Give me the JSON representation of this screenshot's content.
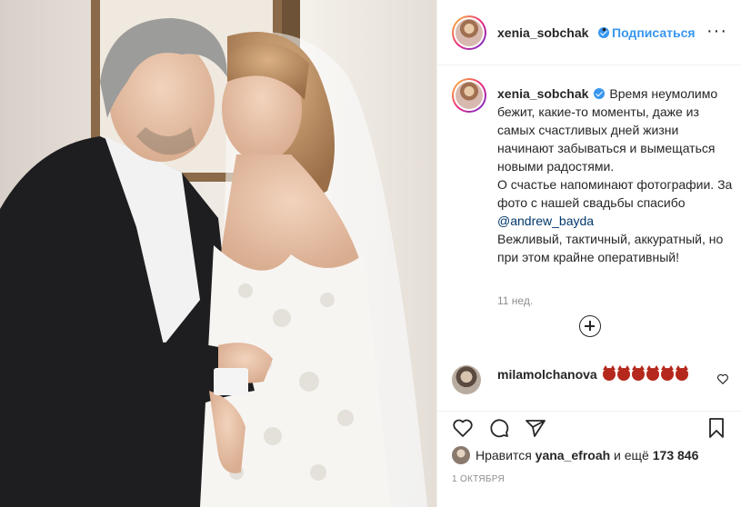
{
  "post": {
    "author": "xenia_sobchak",
    "follow_label": "Подписаться",
    "separator": "•",
    "more_label": "···"
  },
  "caption": {
    "author": "xenia_sobchak",
    "text_1": "Время неумолимо бежит, какие-то моменты, даже из самых счастливых дней жизни начинают забываться и вымещаться новыми радостями.",
    "text_2": "О счастье напоминают фотографии. За фото с нашей свадьбы спасибо ",
    "mention": "@andrew_bayda",
    "text_3": "Вежливый, тактичный, аккуратный, но при этом крайне оперативный!",
    "time": "11 нед."
  },
  "comment": {
    "author": "milamolchanova",
    "emoji_count": 6,
    "emoji_name": "devil-face"
  },
  "actions": {
    "like_icon": "heart-icon",
    "comment_icon": "comment-icon",
    "share_icon": "paper-plane-icon",
    "save_icon": "bookmark-icon"
  },
  "likes": {
    "prefix": "Нравится",
    "user": "yana_efroah",
    "middle": "и ещё",
    "count": "173 846"
  },
  "date": "1 ОКТЯБРЯ",
  "colors": {
    "link_blue": "#3897f0",
    "mention": "#00376b",
    "muted": "#8e8e8e",
    "border": "#efefef"
  }
}
